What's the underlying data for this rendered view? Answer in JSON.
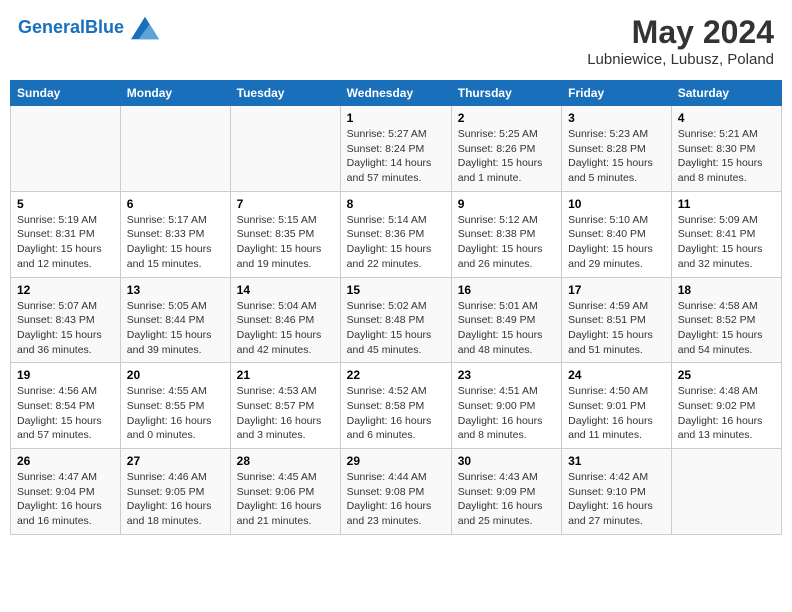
{
  "header": {
    "logo_line1": "General",
    "logo_line2": "Blue",
    "main_title": "May 2024",
    "subtitle": "Lubniewice, Lubusz, Poland"
  },
  "days_of_week": [
    "Sunday",
    "Monday",
    "Tuesday",
    "Wednesday",
    "Thursday",
    "Friday",
    "Saturday"
  ],
  "weeks": [
    [
      {
        "day": "",
        "info": ""
      },
      {
        "day": "",
        "info": ""
      },
      {
        "day": "",
        "info": ""
      },
      {
        "day": "1",
        "info": "Sunrise: 5:27 AM\nSunset: 8:24 PM\nDaylight: 14 hours and 57 minutes."
      },
      {
        "day": "2",
        "info": "Sunrise: 5:25 AM\nSunset: 8:26 PM\nDaylight: 15 hours and 1 minute."
      },
      {
        "day": "3",
        "info": "Sunrise: 5:23 AM\nSunset: 8:28 PM\nDaylight: 15 hours and 5 minutes."
      },
      {
        "day": "4",
        "info": "Sunrise: 5:21 AM\nSunset: 8:30 PM\nDaylight: 15 hours and 8 minutes."
      }
    ],
    [
      {
        "day": "5",
        "info": "Sunrise: 5:19 AM\nSunset: 8:31 PM\nDaylight: 15 hours and 12 minutes."
      },
      {
        "day": "6",
        "info": "Sunrise: 5:17 AM\nSunset: 8:33 PM\nDaylight: 15 hours and 15 minutes."
      },
      {
        "day": "7",
        "info": "Sunrise: 5:15 AM\nSunset: 8:35 PM\nDaylight: 15 hours and 19 minutes."
      },
      {
        "day": "8",
        "info": "Sunrise: 5:14 AM\nSunset: 8:36 PM\nDaylight: 15 hours and 22 minutes."
      },
      {
        "day": "9",
        "info": "Sunrise: 5:12 AM\nSunset: 8:38 PM\nDaylight: 15 hours and 26 minutes."
      },
      {
        "day": "10",
        "info": "Sunrise: 5:10 AM\nSunset: 8:40 PM\nDaylight: 15 hours and 29 minutes."
      },
      {
        "day": "11",
        "info": "Sunrise: 5:09 AM\nSunset: 8:41 PM\nDaylight: 15 hours and 32 minutes."
      }
    ],
    [
      {
        "day": "12",
        "info": "Sunrise: 5:07 AM\nSunset: 8:43 PM\nDaylight: 15 hours and 36 minutes."
      },
      {
        "day": "13",
        "info": "Sunrise: 5:05 AM\nSunset: 8:44 PM\nDaylight: 15 hours and 39 minutes."
      },
      {
        "day": "14",
        "info": "Sunrise: 5:04 AM\nSunset: 8:46 PM\nDaylight: 15 hours and 42 minutes."
      },
      {
        "day": "15",
        "info": "Sunrise: 5:02 AM\nSunset: 8:48 PM\nDaylight: 15 hours and 45 minutes."
      },
      {
        "day": "16",
        "info": "Sunrise: 5:01 AM\nSunset: 8:49 PM\nDaylight: 15 hours and 48 minutes."
      },
      {
        "day": "17",
        "info": "Sunrise: 4:59 AM\nSunset: 8:51 PM\nDaylight: 15 hours and 51 minutes."
      },
      {
        "day": "18",
        "info": "Sunrise: 4:58 AM\nSunset: 8:52 PM\nDaylight: 15 hours and 54 minutes."
      }
    ],
    [
      {
        "day": "19",
        "info": "Sunrise: 4:56 AM\nSunset: 8:54 PM\nDaylight: 15 hours and 57 minutes."
      },
      {
        "day": "20",
        "info": "Sunrise: 4:55 AM\nSunset: 8:55 PM\nDaylight: 16 hours and 0 minutes."
      },
      {
        "day": "21",
        "info": "Sunrise: 4:53 AM\nSunset: 8:57 PM\nDaylight: 16 hours and 3 minutes."
      },
      {
        "day": "22",
        "info": "Sunrise: 4:52 AM\nSunset: 8:58 PM\nDaylight: 16 hours and 6 minutes."
      },
      {
        "day": "23",
        "info": "Sunrise: 4:51 AM\nSunset: 9:00 PM\nDaylight: 16 hours and 8 minutes."
      },
      {
        "day": "24",
        "info": "Sunrise: 4:50 AM\nSunset: 9:01 PM\nDaylight: 16 hours and 11 minutes."
      },
      {
        "day": "25",
        "info": "Sunrise: 4:48 AM\nSunset: 9:02 PM\nDaylight: 16 hours and 13 minutes."
      }
    ],
    [
      {
        "day": "26",
        "info": "Sunrise: 4:47 AM\nSunset: 9:04 PM\nDaylight: 16 hours and 16 minutes."
      },
      {
        "day": "27",
        "info": "Sunrise: 4:46 AM\nSunset: 9:05 PM\nDaylight: 16 hours and 18 minutes."
      },
      {
        "day": "28",
        "info": "Sunrise: 4:45 AM\nSunset: 9:06 PM\nDaylight: 16 hours and 21 minutes."
      },
      {
        "day": "29",
        "info": "Sunrise: 4:44 AM\nSunset: 9:08 PM\nDaylight: 16 hours and 23 minutes."
      },
      {
        "day": "30",
        "info": "Sunrise: 4:43 AM\nSunset: 9:09 PM\nDaylight: 16 hours and 25 minutes."
      },
      {
        "day": "31",
        "info": "Sunrise: 4:42 AM\nSunset: 9:10 PM\nDaylight: 16 hours and 27 minutes."
      },
      {
        "day": "",
        "info": ""
      }
    ]
  ]
}
